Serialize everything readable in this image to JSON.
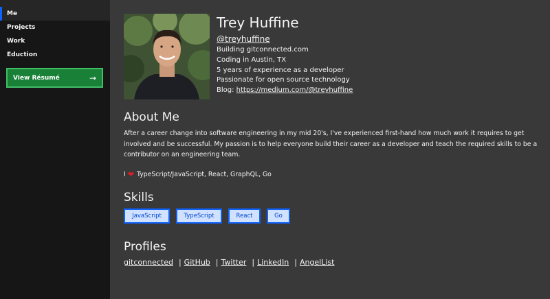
{
  "sidebar": {
    "items": [
      {
        "label": "Me",
        "active": true
      },
      {
        "label": "Projects"
      },
      {
        "label": "Work"
      },
      {
        "label": "Eduction"
      }
    ],
    "resume_button": {
      "label": "View Résumé",
      "icon": "arrow-right-icon"
    }
  },
  "profile": {
    "name": "Trey Huffine",
    "handle": "@treyhuffine",
    "lines": [
      "Building gitconnected.com",
      "Coding in Austin, TX",
      "5 years of experience as a developer",
      "Passionate for open source technology"
    ],
    "blog_label": "Blog: ",
    "blog_url": "https://medium.com/@treyhuffine"
  },
  "about": {
    "title": "About Me",
    "text": "After a career change into software engineering in my mid 20's, I've experienced first-hand how much work it requires to get involved and be successful. My passion is to help everyone build their career as a developer and teach the required skills to be a contributor on an engineering team.",
    "love_prefix": "I",
    "love_text": "TypeScript/JavaScript, React, GraphQL, Go"
  },
  "skills": {
    "title": "Skills",
    "tags": [
      "JavaScript",
      "TypeScript",
      "React",
      "Go"
    ]
  },
  "profiles": {
    "title": "Profiles",
    "links": [
      "gitconnected",
      "GitHub",
      "Twitter",
      "LinkedIn",
      "AngelList"
    ],
    "separator": "|"
  },
  "colors": {
    "accent": "#0f62fe",
    "button_green": "#198038",
    "heart": "#da1e28"
  }
}
